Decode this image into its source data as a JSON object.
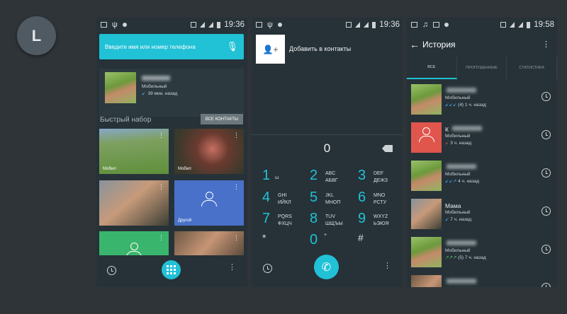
{
  "avatar_letter": "L",
  "screens": {
    "contacts": {
      "status_time": "19:36",
      "search_placeholder": "Введите имя или номер телефона",
      "recent": {
        "type": "Мобильный",
        "time": "39 мин. назад"
      },
      "speed_dial_title": "Быстрый набор",
      "all_contacts_button": "ВСЕ КОНТАКТЫ",
      "tiles": [
        {
          "label": "Мобил"
        },
        {
          "label": "Мобил"
        },
        {
          "label": ""
        },
        {
          "label": "Другой"
        },
        {
          "label": ""
        },
        {
          "label": ""
        }
      ]
    },
    "dialer": {
      "status_time": "19:36",
      "add_to_contacts": "Добавить в контакты",
      "display": "0",
      "keys": [
        {
          "digit": "1",
          "letters": "ω"
        },
        {
          "digit": "2",
          "letters": "ABC\nАБВГ"
        },
        {
          "digit": "3",
          "letters": "DEF\nДЕЖЗ"
        },
        {
          "digit": "4",
          "letters": "GHI\nИЙКЛ"
        },
        {
          "digit": "5",
          "letters": "JKL\nМНОП"
        },
        {
          "digit": "6",
          "letters": "MNO\nРСТУ"
        },
        {
          "digit": "7",
          "letters": "PQRS\nФХЦЧ"
        },
        {
          "digit": "8",
          "letters": "TUV\nШЩЪЫ"
        },
        {
          "digit": "9",
          "letters": "WXYZ\nЬЭЮЯ"
        },
        {
          "digit": "*",
          "letters": ""
        },
        {
          "digit": "0",
          "letters": "+"
        },
        {
          "digit": "#",
          "letters": ""
        }
      ]
    },
    "history": {
      "status_time": "19:58",
      "title": "История",
      "tabs": [
        "ВСЕ",
        "ПРОПУЩЕННЫЕ",
        "СТАТИСТИКА"
      ],
      "rows": [
        {
          "name": "",
          "type": "Мобильный",
          "arrows": "↙↙↙",
          "arrow_kind": "in",
          "detail": "(4) 1 ч. назад"
        },
        {
          "name": "К",
          "type": "Мобильный",
          "arrows": "↙",
          "arrow_kind": "miss",
          "detail": "3 ч. назад"
        },
        {
          "name": "",
          "type": "Мобильный",
          "arrows": "↙↙↗",
          "arrow_kind": "in",
          "detail": "4 ч. назад"
        },
        {
          "name": "Мама",
          "type": "Мобильный",
          "arrows": "↙",
          "arrow_kind": "in",
          "detail": "7 ч. назад"
        },
        {
          "name": "",
          "type": "Мобильный",
          "arrows": "↗↗↗",
          "arrow_kind": "out",
          "detail": "(5) 7 ч. назад"
        },
        {
          "name": "",
          "type": "",
          "arrows": "",
          "arrow_kind": "in",
          "detail": ""
        }
      ]
    }
  }
}
